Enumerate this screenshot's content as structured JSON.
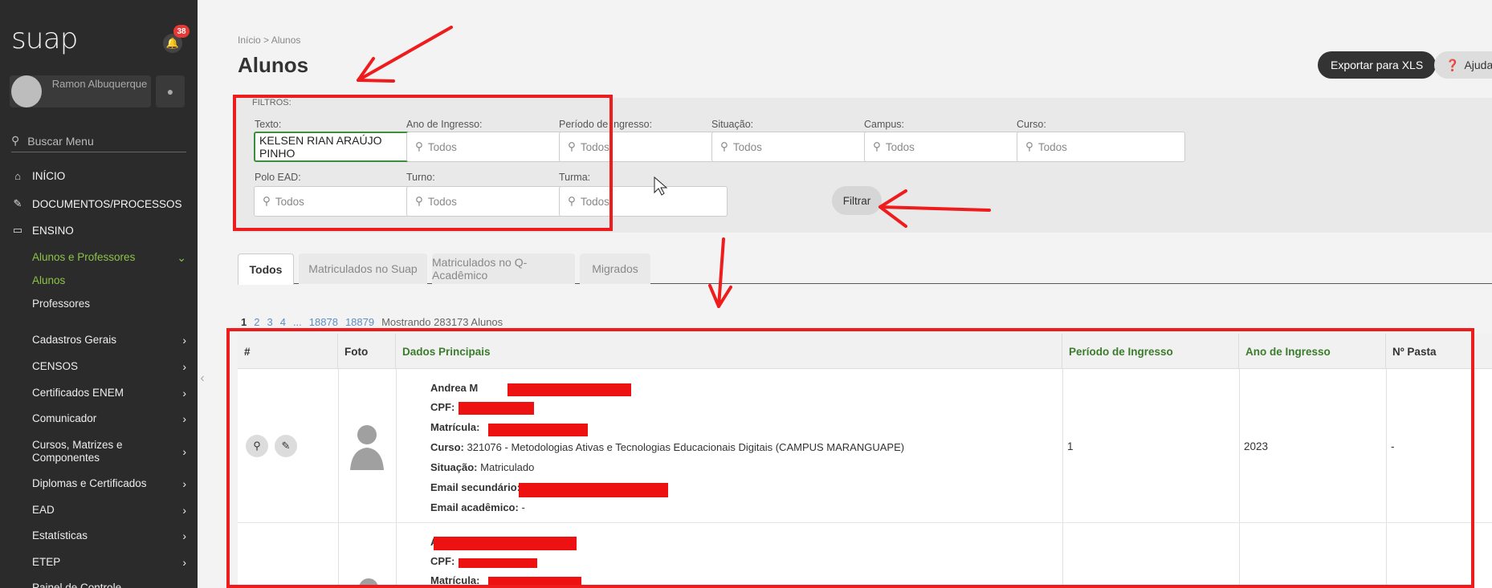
{
  "sidebar": {
    "logo": "suap",
    "notifications": "38",
    "user_name": "Ramon Albuquerque",
    "search_label": "Buscar Menu",
    "main_items": [
      {
        "icon": "home-icon",
        "label": "INÍCIO"
      },
      {
        "icon": "document-icon",
        "label": "DOCUMENTOS/PROCESSOS"
      },
      {
        "icon": "teaching-icon",
        "label": "ENSINO"
      }
    ],
    "group_label": "Alunos e Professores",
    "sub_items": [
      "Alunos",
      "Professores"
    ],
    "items": [
      "Cadastros Gerais",
      "CENSOS",
      "Certificados ENEM",
      "Comunicador",
      "Cursos, Matrizes e Componentes",
      "Diplomas e Certificados",
      "EAD",
      "Estatísticas",
      "ETEP",
      "Painel de Controle"
    ]
  },
  "header": {
    "breadcrumb": "Início > Alunos",
    "title": "Alunos",
    "export_label": "Exportar para XLS",
    "help_label": "Ajuda"
  },
  "filters": {
    "title": "FILTROS:",
    "texto_label": "Texto:",
    "texto_value": "KELSEN RIAN ARAÚJO PINHO",
    "ano_label": "Ano de Ingresso:",
    "periodo_label": "Período de Ingresso:",
    "situacao_label": "Situação:",
    "campus_label": "Campus:",
    "curso_label": "Curso:",
    "polo_label": "Polo EAD:",
    "turno_label": "Turno:",
    "turma_label": "Turma:",
    "placeholder": "Todos",
    "submit_label": "Filtrar"
  },
  "tabs": [
    "Todos",
    "Matriculados no Suap",
    "Matriculados no Q-Acadêmico",
    "Migrados"
  ],
  "pagination": {
    "pages": [
      "1",
      "2",
      "3",
      "4",
      "...",
      "18878",
      "18879"
    ],
    "info": "Mostrando 283173 Alunos"
  },
  "table": {
    "headers": [
      "#",
      "Foto",
      "Dados Principais",
      "Período de Ingresso",
      "Ano de Ingresso",
      "Nº Pasta"
    ],
    "row1": {
      "name_prefix": "Andrea M",
      "cpf_label": "CPF:",
      "matricula_label": "Matrícula:",
      "curso_label": "Curso:",
      "curso_value": "321076 - Metodologias Ativas e Tecnologias Educacionais Digitais (CAMPUS MARANGUAPE)",
      "situacao_label": "Situação:",
      "situacao_value": "Matriculado",
      "email_sec_label": "Email secundário:",
      "email_acad_label": "Email acadêmico:",
      "email_acad_value": "-",
      "periodo": "1",
      "ano": "2023",
      "pasta": "-"
    },
    "row2": {
      "name_prefix": "A",
      "cpf_label": "CPF:",
      "matricula_label": "Matrícula:"
    }
  },
  "colors": {
    "sidebar_bg": "#2b2b2b",
    "accent_green": "#8bc34a",
    "header_green": "#3b7c2c",
    "annotation_red": "#ee1c1c"
  }
}
